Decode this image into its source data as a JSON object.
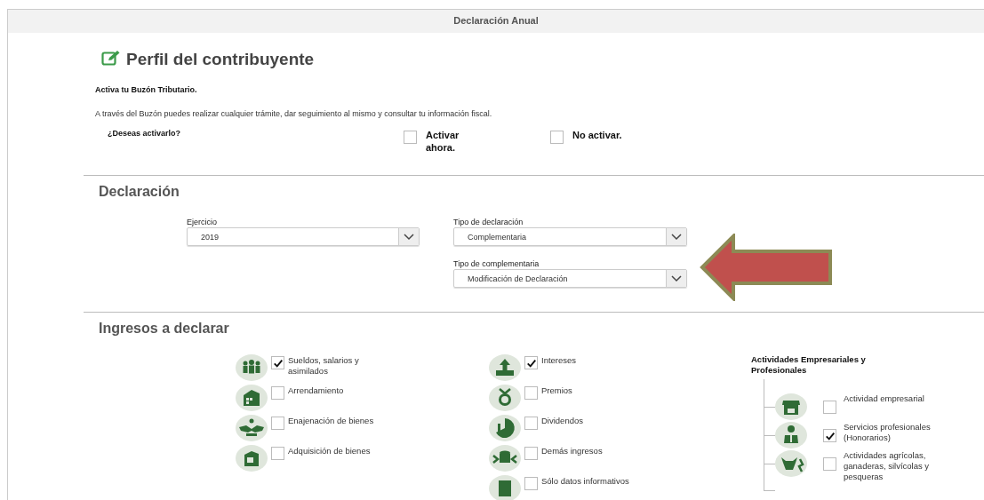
{
  "title": "Declaración Anual",
  "profile": {
    "heading": "Perfil del contribuyente",
    "notice_title": "Activa tu Buzón Tributario.",
    "notice_text": "A través del Buzón puedes realizar cualquier trámite, dar seguimiento al mismo y consultar tu información fiscal.",
    "question": "¿Deseas activarlo?",
    "options": [
      {
        "label": "Activar ahora.",
        "checked": false
      },
      {
        "label": "No activar.",
        "checked": false
      }
    ]
  },
  "declaration": {
    "heading": "Declaración",
    "fields": [
      {
        "label": "Ejercicio",
        "value": "2019"
      },
      {
        "label": "Tipo de declaración",
        "value": "Complementaria"
      },
      {
        "label": "Tipo de complementaria",
        "value": "Modificación de Declaración"
      }
    ]
  },
  "income": {
    "heading": "Ingresos a declarar",
    "columns": [
      [
        {
          "label": "Sueldos, salarios y asimilados",
          "checked": true
        },
        {
          "label": "Arrendamiento",
          "checked": false
        },
        {
          "label": "Enajenación de bienes",
          "checked": false
        },
        {
          "label": "Adquisición de bienes",
          "checked": false
        }
      ],
      [
        {
          "label": "Intereses",
          "checked": true
        },
        {
          "label": "Premios",
          "checked": false
        },
        {
          "label": "Dividendos",
          "checked": false
        },
        {
          "label": "Demás ingresos",
          "checked": false
        },
        {
          "label": "Sólo datos informativos",
          "checked": false
        }
      ]
    ],
    "business": {
      "heading": "Actividades Empresariales y Profesionales",
      "items": [
        {
          "label": "Actividad empresarial",
          "checked": false
        },
        {
          "label": "Servicios profesionales (Honorarios)",
          "checked": true
        },
        {
          "label": "Actividades agrícolas, ganaderas, silvícolas y pesqueras",
          "checked": false
        }
      ]
    }
  }
}
